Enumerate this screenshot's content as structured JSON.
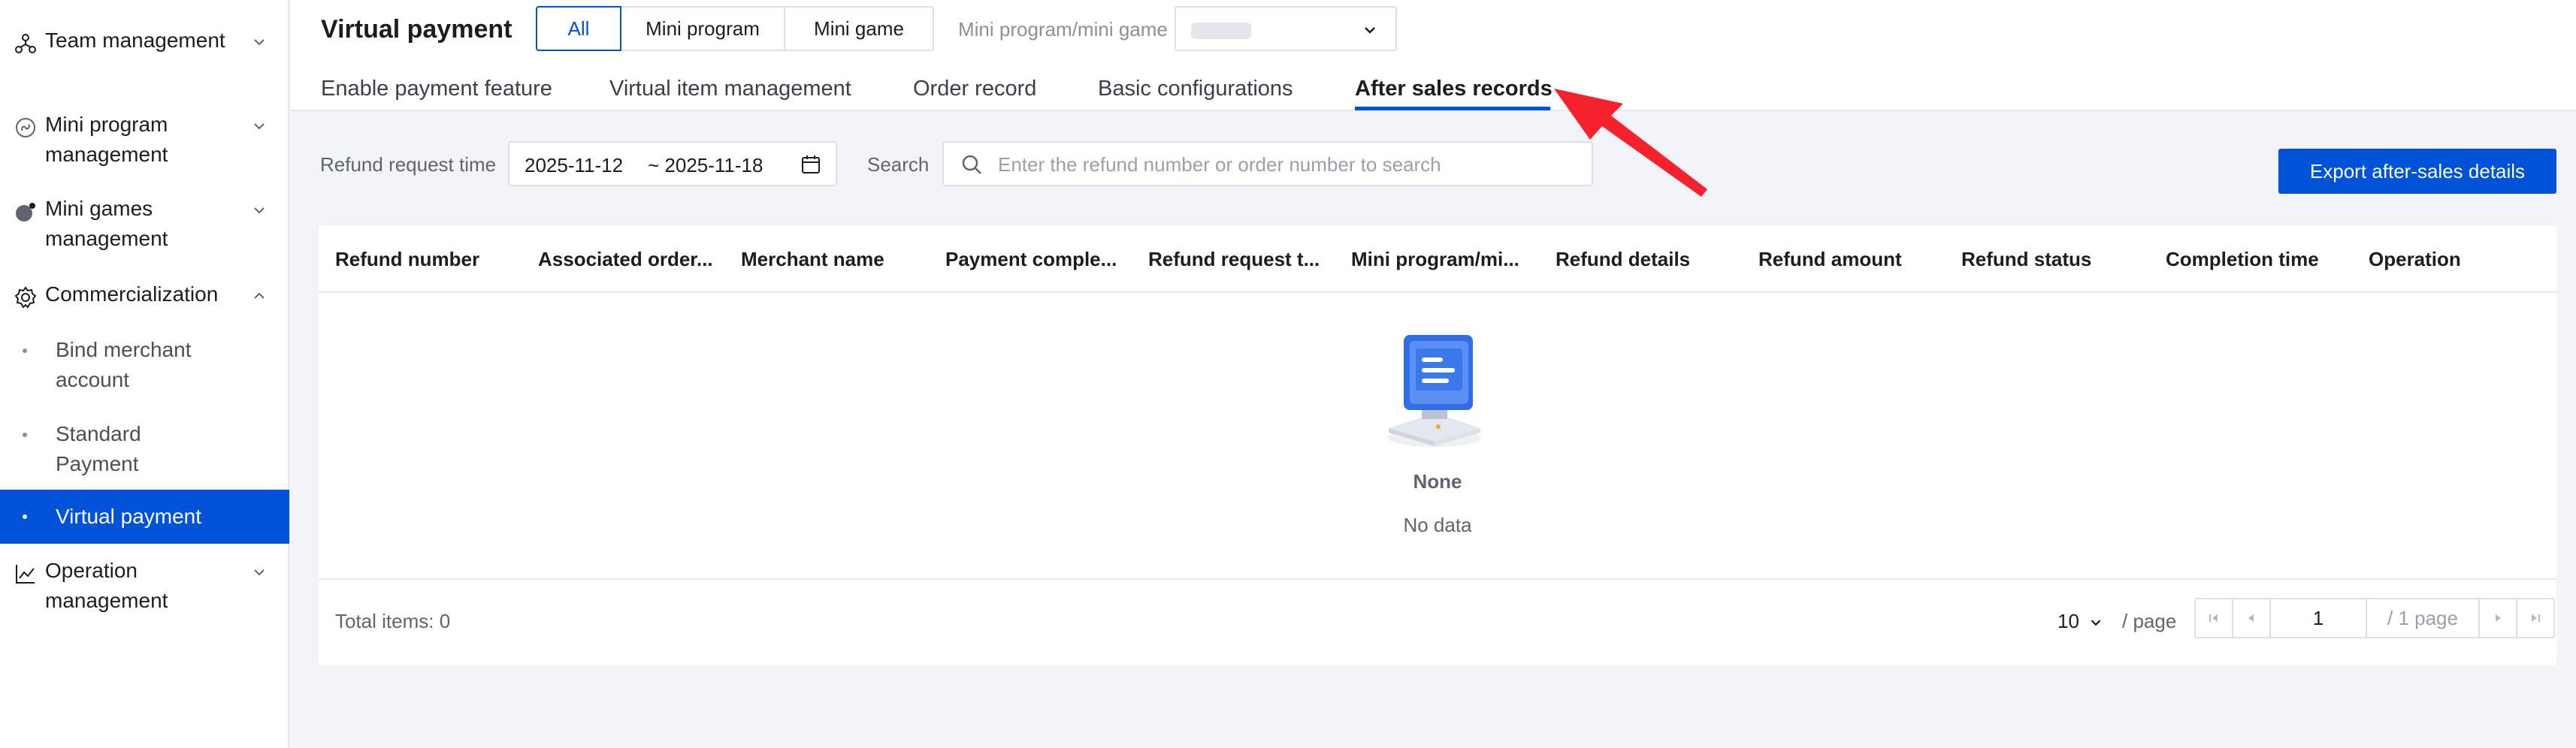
{
  "sidebar": {
    "items": [
      {
        "label": "Team management",
        "icon": "team-icon",
        "expanded": false
      },
      {
        "label": "Mini program management",
        "icon": "mini-program-icon",
        "expanded": false
      },
      {
        "label": "Mini games management",
        "icon": "mini-game-icon",
        "expanded": false
      },
      {
        "label": "Commercialization",
        "icon": "gear-icon",
        "expanded": true,
        "children": [
          {
            "label": "Bind merchant account"
          },
          {
            "label": "Standard Payment"
          },
          {
            "label": "Virtual payment",
            "active": true
          }
        ]
      },
      {
        "label": "Operation management",
        "icon": "chart-icon",
        "expanded": false
      }
    ]
  },
  "header": {
    "title": "Virtual payment",
    "segments": [
      "All",
      "Mini program",
      "Mini game"
    ],
    "active_segment": "All",
    "filter_label": "Mini program/mini game",
    "tabs": [
      {
        "label": "Enable payment feature"
      },
      {
        "label": "Virtual item management"
      },
      {
        "label": "Order record"
      },
      {
        "label": "Basic configurations"
      },
      {
        "label": "After sales records",
        "active": true
      }
    ]
  },
  "filters": {
    "date_label": "Refund request time",
    "date_start": "2025-11-12",
    "date_end": "~ 2025-11-18",
    "search_label": "Search",
    "search_placeholder": "Enter the refund number or order number to search",
    "search_value": "",
    "export_label": "Export after-sales details"
  },
  "table": {
    "columns": [
      "Refund number",
      "Associated order...",
      "Merchant name",
      "Payment comple...",
      "Refund request t...",
      "Mini program/mi...",
      "Refund details",
      "Refund amount",
      "Refund status",
      "Completion time",
      "Operation"
    ],
    "rows": [],
    "empty_title": "None",
    "empty_subtitle": "No data"
  },
  "pagination": {
    "total": "Total items: 0",
    "page_size": "10",
    "per_page_label": "/ page",
    "current_page": "1",
    "total_pages": "/ 1 page"
  },
  "colors": {
    "primary": "#0052d9",
    "annotation": "#f5222d",
    "background": "#f3f4f7"
  }
}
